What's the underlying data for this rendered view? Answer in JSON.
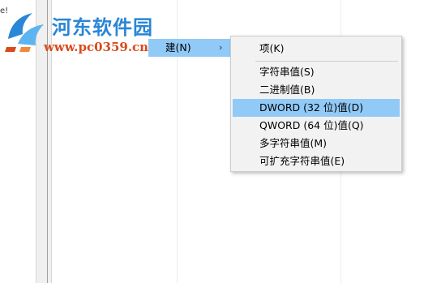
{
  "left_edge_text": "e!",
  "parent_menu": {
    "label": "建(N)",
    "arrow": "›"
  },
  "submenu": {
    "items": [
      {
        "label": "项(K)"
      },
      {
        "label": "字符串值(S)"
      },
      {
        "label": "二进制值(B)"
      },
      {
        "label": "DWORD (32 位)值(D)"
      },
      {
        "label": "QWORD (64 位)值(Q)"
      },
      {
        "label": "多字符串值(M)"
      },
      {
        "label": "可扩充字符串值(E)"
      }
    ]
  },
  "watermark": {
    "title": "河东软件园",
    "url": "www.pc0359.cn"
  },
  "colors": {
    "highlight": "#91c9f7",
    "menu_bg": "#f2f2f2",
    "watermark_blue": "#2a86d6",
    "watermark_orange": "#d84a1a"
  }
}
